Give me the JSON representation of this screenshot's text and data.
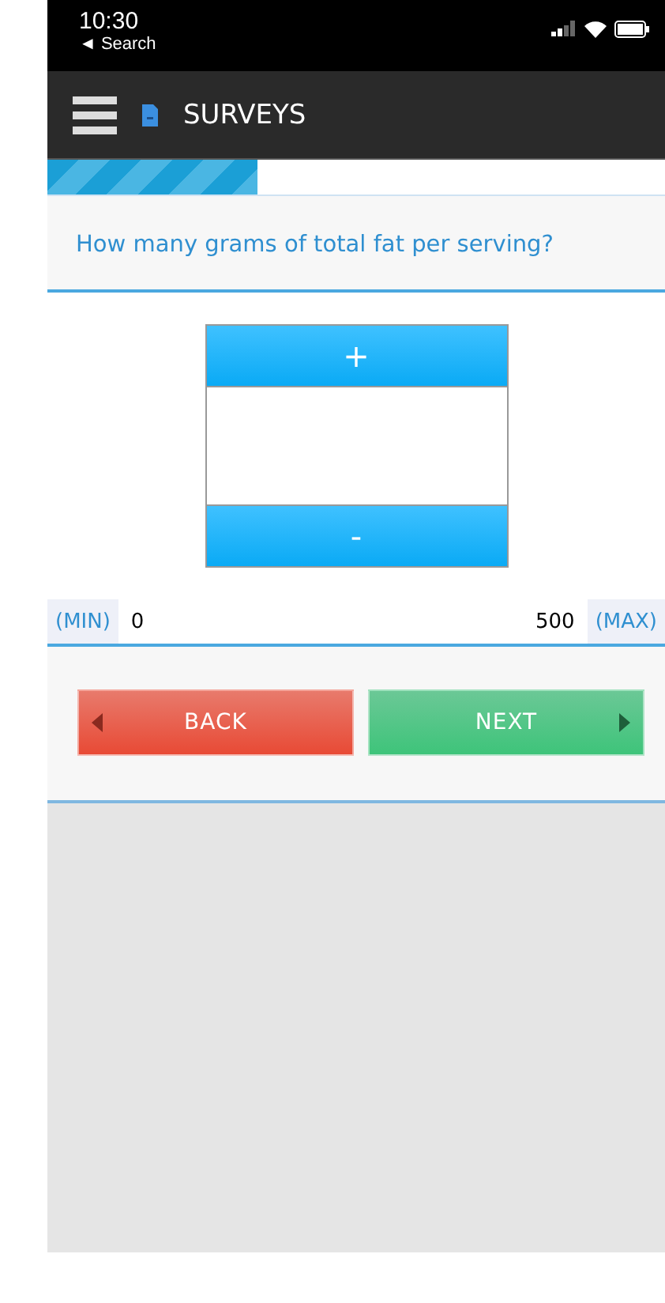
{
  "status_bar": {
    "time": "10:30",
    "back_link": "◄ Search"
  },
  "header": {
    "title": "SURVEYS"
  },
  "progress": {
    "level": 0.34
  },
  "question": {
    "text": "How many grams of total fat per serving?"
  },
  "stepper": {
    "increment": "+",
    "decrement": "-"
  },
  "range": {
    "min_label": "(MIN)",
    "min_value": "0",
    "max_value": "500",
    "max_label": "(MAX)"
  },
  "buttons": [
    {
      "kind": "back",
      "label": "BACK"
    },
    {
      "kind": "next",
      "label": "NEXT"
    }
  ]
}
